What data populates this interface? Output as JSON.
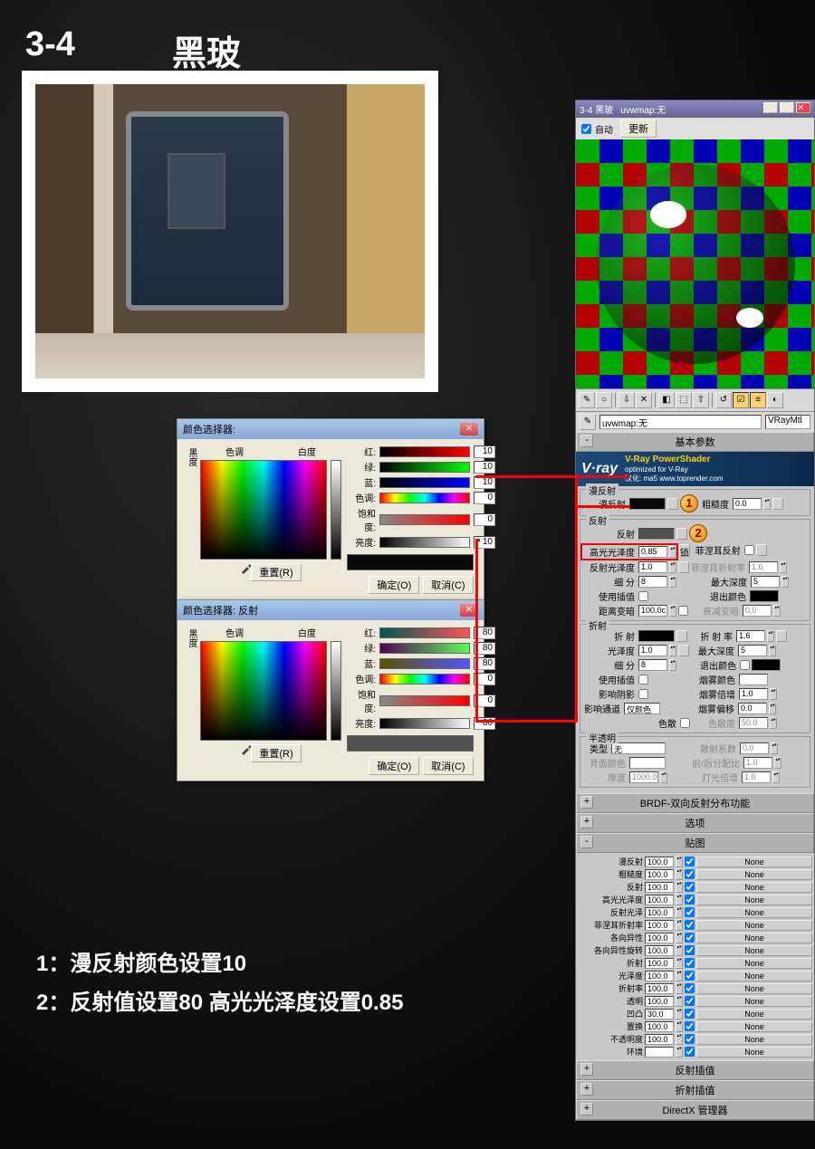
{
  "page": {
    "number": "3-4",
    "title": "黑玻"
  },
  "instructions": {
    "line1": "1：漫反射颜色设置10",
    "line2": "2：反射值设置80  高光光泽度设置0.85"
  },
  "color_picker_1": {
    "title": "颜色选择器:",
    "hue_label": "色调",
    "white_label": "白度",
    "black_label": "黑度",
    "reset": "重置(R)",
    "ok": "确定(O)",
    "cancel": "取消(C)",
    "rgb": {
      "r_label": "红:",
      "r": "10",
      "g_label": "绿:",
      "g": "10",
      "b_label": "蓝:",
      "b": "10"
    },
    "hsv": {
      "h_label": "色调:",
      "h": "0",
      "s_label": "饱和度:",
      "s": "0",
      "v_label": "亮度:",
      "v": "10"
    },
    "swatch": "#0a0a0a"
  },
  "color_picker_2": {
    "title": "颜色选择器: 反射",
    "hue_label": "色调",
    "white_label": "白度",
    "black_label": "黑度",
    "reset": "重置(R)",
    "ok": "确定(O)",
    "cancel": "取消(C)",
    "rgb": {
      "r_label": "红:",
      "r": "80",
      "g_label": "绿:",
      "g": "80",
      "b_label": "蓝:",
      "b": "80"
    },
    "hsv": {
      "h_label": "色调:",
      "h": "0",
      "s_label": "饱和度:",
      "s": "0",
      "v_label": "亮度:",
      "v": "80"
    },
    "swatch": "#505050"
  },
  "vray": {
    "window_title_left": "3-4  黑玻",
    "window_title_right": "uvwmap:无",
    "auto": "自动",
    "update": "更新",
    "uvw": "uvwmap:无",
    "material_name": "VRayMtl",
    "sections": {
      "basic": "基本参数",
      "brdf": "BRDF-双向反射分布功能",
      "options": "选项",
      "maps": "贴图",
      "reflect_interp": "反射插值",
      "refract_interp": "折射插值",
      "directx": "DirectX 管理器"
    },
    "logo": {
      "brand": "V·ray",
      "line1": "V-Ray PowerShader",
      "line2": "optimized for V-Ray",
      "line3": "汉化: ma5 www.toprender.com"
    },
    "diffuse": {
      "group": "漫反射",
      "diffuse_label": "漫反射",
      "diffuse_swatch": "#0a0a0a",
      "roughness_label": "粗糙度",
      "roughness": "0.0"
    },
    "reflection": {
      "group": "反射",
      "reflect_label": "反射",
      "reflect_swatch": "#505050",
      "hilight_gloss_label": "高光光泽度",
      "hilight_gloss": "0.85",
      "lock_label": "锁",
      "reflect_gloss_label": "反射光泽度",
      "reflect_gloss": "1.0",
      "subdivs_label": "细 分",
      "subdivs": "8",
      "use_interp_label": "使用插值",
      "dim_dist_label": "距离变暗",
      "dim_dist": "100.0c",
      "fresnel_label": "菲涅耳反射",
      "fresnel_ior_label": "菲涅耳折射率",
      "fresnel_ior": "1.6",
      "max_depth_label": "最大深度",
      "max_depth": "5",
      "exit_color_label": "退出颜色",
      "dim_falloff_label": "衰减变暗",
      "dim_falloff": "0.0"
    },
    "refraction": {
      "group": "折射",
      "refract_label": "折 射",
      "refract_swatch": "#000000",
      "glossiness_label": "光泽度",
      "glossiness": "1.0",
      "subdivs_label": "细 分",
      "subdivs": "8",
      "use_interp_label": "使用插值",
      "affect_shadows_label": "影响阴影",
      "affect_channels_label": "影响通道",
      "affect_channels_value": "仅颜色",
      "ior_label": "折 射 率",
      "ior": "1.6",
      "max_depth_label": "最大深度",
      "max_depth": "5",
      "exit_color_label": "退出颜色",
      "fog_color_label": "烟雾颜色",
      "fog_swatch": "#ffffff",
      "fog_mult_label": "烟雾倍增",
      "fog_mult": "1.0",
      "fog_bias_label": "烟雾偏移",
      "fog_bias": "0.0",
      "dispersion_label": "色散",
      "dispersion_val_label": "色散度",
      "dispersion_val": "50.0"
    },
    "translucency": {
      "group": "半透明",
      "type_label": "类型",
      "type": "无",
      "back_color_label": "背面颜色",
      "back_swatch": "#ffffff",
      "thickness_label": "厚度",
      "thickness": "1000.0",
      "scatter_label": "散射系数",
      "scatter": "0.0",
      "fwd_back_label": "前/后分配比",
      "fwd_back": "1.0",
      "light_mult_label": "灯光倍增",
      "light_mult": "1.0"
    },
    "maps": [
      {
        "label": "漫反射",
        "val": "100.0",
        "on": true,
        "btn": "None"
      },
      {
        "label": "粗糙度",
        "val": "100.0",
        "on": true,
        "btn": "None"
      },
      {
        "label": "反射",
        "val": "100.0",
        "on": true,
        "btn": "None"
      },
      {
        "label": "高光光泽度",
        "val": "100.0",
        "on": true,
        "btn": "None"
      },
      {
        "label": "反射光泽",
        "val": "100.0",
        "on": true,
        "btn": "None"
      },
      {
        "label": "菲涅耳折射率",
        "val": "100.0",
        "on": true,
        "btn": "None"
      },
      {
        "label": "各向异性",
        "val": "100.0",
        "on": true,
        "btn": "None"
      },
      {
        "label": "各向异性旋转",
        "val": "100.0",
        "on": true,
        "btn": "None"
      },
      {
        "label": "折射",
        "val": "100.0",
        "on": true,
        "btn": "None"
      },
      {
        "label": "光泽度",
        "val": "100.0",
        "on": true,
        "btn": "None"
      },
      {
        "label": "折射率",
        "val": "100.0",
        "on": true,
        "btn": "None"
      },
      {
        "label": "透明",
        "val": "100.0",
        "on": true,
        "btn": "None"
      },
      {
        "label": "凹凸",
        "val": "30.0",
        "on": true,
        "btn": "None"
      },
      {
        "label": "置换",
        "val": "100.0",
        "on": true,
        "btn": "None"
      },
      {
        "label": "不透明度",
        "val": "100.0",
        "on": true,
        "btn": "None"
      },
      {
        "label": "环境",
        "val": "",
        "on": true,
        "btn": "None"
      }
    ]
  }
}
